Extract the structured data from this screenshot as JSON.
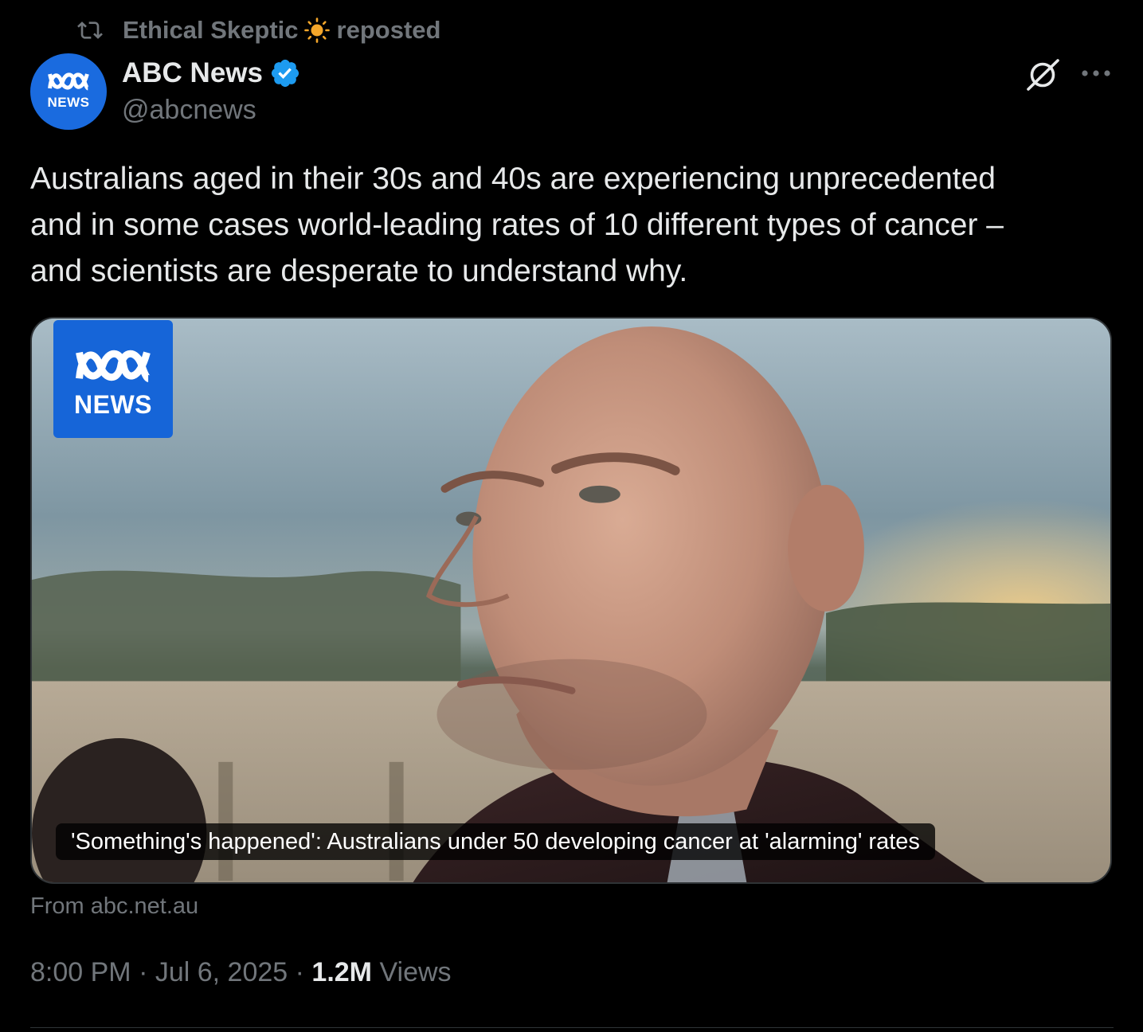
{
  "repost": {
    "reposter": "Ethical Skeptic",
    "action": "reposted",
    "icon": "repost-icon",
    "emoji_icon": "sun-icon"
  },
  "author": {
    "name": "ABC News",
    "handle": "@abcnews",
    "verified": true,
    "verified_color": "#1d9bf0",
    "avatar_label": "NEWS",
    "avatar_color": "#1a6bdf"
  },
  "actions": {
    "grok_icon": "grok-icon",
    "more_icon": "more-icon"
  },
  "tweet": {
    "text": "Australians aged in their 30s and 40s are experiencing unprecedented\nand in some cases world-leading rates of 10 different types of cancer –\nand scientists are desperate to understand why."
  },
  "media": {
    "logo_label": "NEWS",
    "caption": "'Something's happened': Australians under 50 developing cancer at 'alarming' rates"
  },
  "card_source": "From abc.net.au",
  "meta": {
    "time": "8:00 PM",
    "separator1": " · ",
    "date": "Jul 6, 2025",
    "separator2": " · ",
    "views_count": "1.2M",
    "views_label": " Views"
  },
  "colors": {
    "background": "#000000",
    "text_primary": "#e7e9ea",
    "text_secondary": "#71767b",
    "border": "#2f3336",
    "abc_blue": "#1665d8"
  }
}
